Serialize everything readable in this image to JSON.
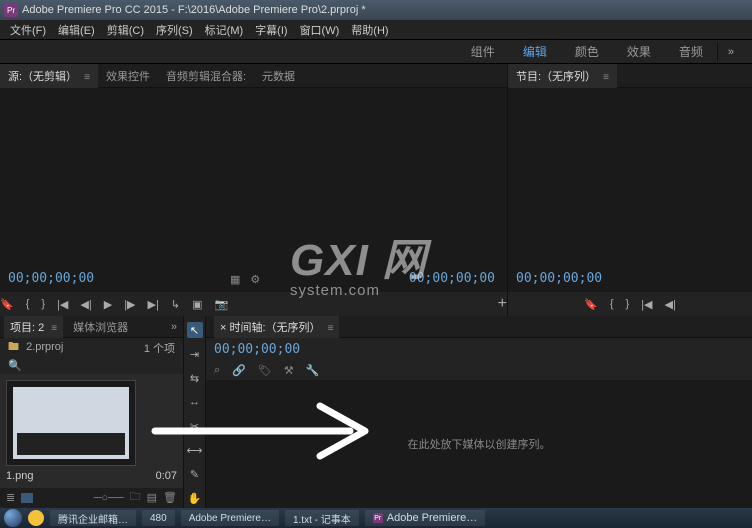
{
  "titlebar": {
    "icon_label": "Pr",
    "text": "Adobe Premiere Pro CC 2015 - F:\\2016\\Adobe Premiere Pro\\2.prproj *"
  },
  "menu": {
    "file": "文件(F)",
    "edit": "编辑(E)",
    "clip": "剪辑(C)",
    "sequence": "序列(S)",
    "marker": "标记(M)",
    "subtitle": "字幕(I)",
    "window": "窗口(W)",
    "help": "帮助(H)"
  },
  "workspaces": {
    "assembly": "组件",
    "editing": "编辑",
    "color": "颜色",
    "effects": "效果",
    "audio": "音频",
    "more": "»"
  },
  "source_panel": {
    "tab1": "源:（无剪辑）",
    "tab2": "效果控件",
    "tab3": "音频剪辑混合器:",
    "tab4": "元数据",
    "timecode_left": "00;00;00;00",
    "timecode_right": "00;00;00;00"
  },
  "program_panel": {
    "tab": "节目:（无序列）",
    "timecode": "00;00;00;00"
  },
  "project_panel": {
    "tab1": "项目: 2",
    "tab2": "媒体浏览器",
    "project_name": "2.prproj",
    "item_count": "1 个项",
    "thumb_label": "1.png",
    "thumb_duration": "0:07"
  },
  "timeline_panel": {
    "tab": "× 时间轴:（无序列）",
    "timecode": "00;00;00;00",
    "empty_text": "在此处放下媒体以创建序列。"
  },
  "watermark": {
    "big": "GXI 网",
    "small": "system.com"
  },
  "taskbar": {
    "t1": "腾讯企业邮箱…",
    "t2": "480",
    "t3": "Adobe Premiere…",
    "t4": "1.txt - 记事本",
    "t5": "Adobe Premiere…"
  }
}
